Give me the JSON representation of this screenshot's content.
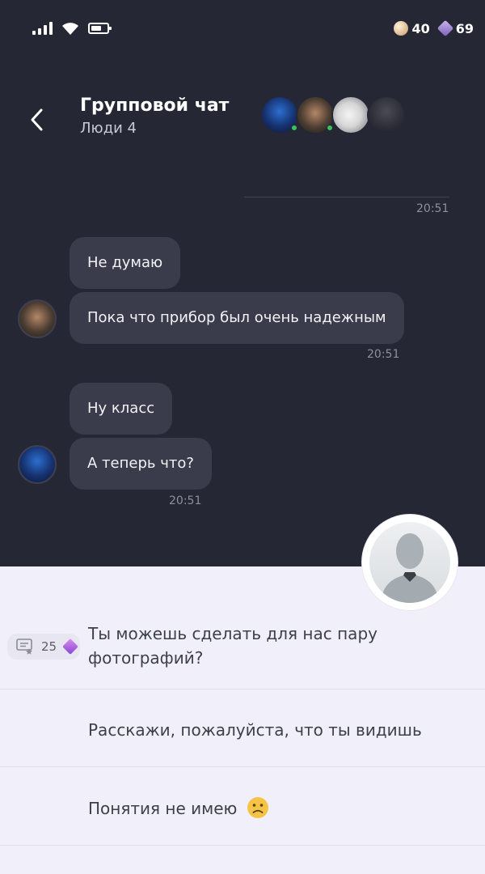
{
  "status_bar": {
    "coins": "40",
    "gems": "69"
  },
  "header": {
    "title": "Групповой чат",
    "subtitle": "Люди 4"
  },
  "chat": {
    "first_time": "20:51",
    "group1": {
      "bubbles": [
        "Не думаю",
        "Пока что прибор был очень надежным"
      ],
      "time": "20:51"
    },
    "group2": {
      "bubbles": [
        "Ну класс",
        "А теперь что?"
      ],
      "time": "20:51"
    }
  },
  "options": [
    {
      "text": "Ты можешь сделать для нас пару фотографий?",
      "cost": "25"
    },
    {
      "text": "Расскажи, пожалуйста, что ты видишь"
    },
    {
      "text": "Понятия не имею"
    }
  ],
  "colors": {
    "background": "#262735",
    "bubble": "#3a3b4b",
    "panel": "#f1f0fa",
    "online": "#37c25a"
  }
}
